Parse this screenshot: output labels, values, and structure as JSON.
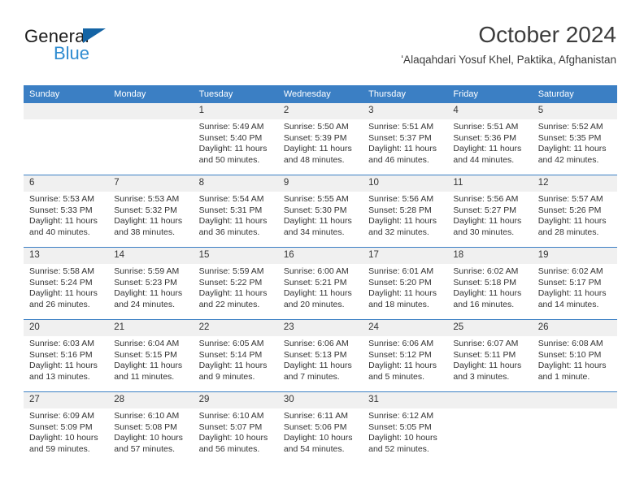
{
  "brand": {
    "name_part1": "General",
    "name_part2": "Blue",
    "triangle_icon": "triangle-icon",
    "accent_color": "#1464a5",
    "secondary_color": "#2e8bd0"
  },
  "header": {
    "title": "October 2024",
    "subtitle": "ʻAlaqahdari Yosuf Khel, Paktika, Afghanistan"
  },
  "calendar": {
    "header_bg": "#3b7fc4",
    "daynum_bg": "#f0f0f0",
    "weekday_headers": [
      "Sunday",
      "Monday",
      "Tuesday",
      "Wednesday",
      "Thursday",
      "Friday",
      "Saturday"
    ],
    "weeks": [
      [
        {
          "day": ""
        },
        {
          "day": ""
        },
        {
          "day": "1",
          "sunrise": "Sunrise: 5:49 AM",
          "sunset": "Sunset: 5:40 PM",
          "daylight1": "Daylight: 11 hours",
          "daylight2": "and 50 minutes."
        },
        {
          "day": "2",
          "sunrise": "Sunrise: 5:50 AM",
          "sunset": "Sunset: 5:39 PM",
          "daylight1": "Daylight: 11 hours",
          "daylight2": "and 48 minutes."
        },
        {
          "day": "3",
          "sunrise": "Sunrise: 5:51 AM",
          "sunset": "Sunset: 5:37 PM",
          "daylight1": "Daylight: 11 hours",
          "daylight2": "and 46 minutes."
        },
        {
          "day": "4",
          "sunrise": "Sunrise: 5:51 AM",
          "sunset": "Sunset: 5:36 PM",
          "daylight1": "Daylight: 11 hours",
          "daylight2": "and 44 minutes."
        },
        {
          "day": "5",
          "sunrise": "Sunrise: 5:52 AM",
          "sunset": "Sunset: 5:35 PM",
          "daylight1": "Daylight: 11 hours",
          "daylight2": "and 42 minutes."
        }
      ],
      [
        {
          "day": "6",
          "sunrise": "Sunrise: 5:53 AM",
          "sunset": "Sunset: 5:33 PM",
          "daylight1": "Daylight: 11 hours",
          "daylight2": "and 40 minutes."
        },
        {
          "day": "7",
          "sunrise": "Sunrise: 5:53 AM",
          "sunset": "Sunset: 5:32 PM",
          "daylight1": "Daylight: 11 hours",
          "daylight2": "and 38 minutes."
        },
        {
          "day": "8",
          "sunrise": "Sunrise: 5:54 AM",
          "sunset": "Sunset: 5:31 PM",
          "daylight1": "Daylight: 11 hours",
          "daylight2": "and 36 minutes."
        },
        {
          "day": "9",
          "sunrise": "Sunrise: 5:55 AM",
          "sunset": "Sunset: 5:30 PM",
          "daylight1": "Daylight: 11 hours",
          "daylight2": "and 34 minutes."
        },
        {
          "day": "10",
          "sunrise": "Sunrise: 5:56 AM",
          "sunset": "Sunset: 5:28 PM",
          "daylight1": "Daylight: 11 hours",
          "daylight2": "and 32 minutes."
        },
        {
          "day": "11",
          "sunrise": "Sunrise: 5:56 AM",
          "sunset": "Sunset: 5:27 PM",
          "daylight1": "Daylight: 11 hours",
          "daylight2": "and 30 minutes."
        },
        {
          "day": "12",
          "sunrise": "Sunrise: 5:57 AM",
          "sunset": "Sunset: 5:26 PM",
          "daylight1": "Daylight: 11 hours",
          "daylight2": "and 28 minutes."
        }
      ],
      [
        {
          "day": "13",
          "sunrise": "Sunrise: 5:58 AM",
          "sunset": "Sunset: 5:24 PM",
          "daylight1": "Daylight: 11 hours",
          "daylight2": "and 26 minutes."
        },
        {
          "day": "14",
          "sunrise": "Sunrise: 5:59 AM",
          "sunset": "Sunset: 5:23 PM",
          "daylight1": "Daylight: 11 hours",
          "daylight2": "and 24 minutes."
        },
        {
          "day": "15",
          "sunrise": "Sunrise: 5:59 AM",
          "sunset": "Sunset: 5:22 PM",
          "daylight1": "Daylight: 11 hours",
          "daylight2": "and 22 minutes."
        },
        {
          "day": "16",
          "sunrise": "Sunrise: 6:00 AM",
          "sunset": "Sunset: 5:21 PM",
          "daylight1": "Daylight: 11 hours",
          "daylight2": "and 20 minutes."
        },
        {
          "day": "17",
          "sunrise": "Sunrise: 6:01 AM",
          "sunset": "Sunset: 5:20 PM",
          "daylight1": "Daylight: 11 hours",
          "daylight2": "and 18 minutes."
        },
        {
          "day": "18",
          "sunrise": "Sunrise: 6:02 AM",
          "sunset": "Sunset: 5:18 PM",
          "daylight1": "Daylight: 11 hours",
          "daylight2": "and 16 minutes."
        },
        {
          "day": "19",
          "sunrise": "Sunrise: 6:02 AM",
          "sunset": "Sunset: 5:17 PM",
          "daylight1": "Daylight: 11 hours",
          "daylight2": "and 14 minutes."
        }
      ],
      [
        {
          "day": "20",
          "sunrise": "Sunrise: 6:03 AM",
          "sunset": "Sunset: 5:16 PM",
          "daylight1": "Daylight: 11 hours",
          "daylight2": "and 13 minutes."
        },
        {
          "day": "21",
          "sunrise": "Sunrise: 6:04 AM",
          "sunset": "Sunset: 5:15 PM",
          "daylight1": "Daylight: 11 hours",
          "daylight2": "and 11 minutes."
        },
        {
          "day": "22",
          "sunrise": "Sunrise: 6:05 AM",
          "sunset": "Sunset: 5:14 PM",
          "daylight1": "Daylight: 11 hours",
          "daylight2": "and 9 minutes."
        },
        {
          "day": "23",
          "sunrise": "Sunrise: 6:06 AM",
          "sunset": "Sunset: 5:13 PM",
          "daylight1": "Daylight: 11 hours",
          "daylight2": "and 7 minutes."
        },
        {
          "day": "24",
          "sunrise": "Sunrise: 6:06 AM",
          "sunset": "Sunset: 5:12 PM",
          "daylight1": "Daylight: 11 hours",
          "daylight2": "and 5 minutes."
        },
        {
          "day": "25",
          "sunrise": "Sunrise: 6:07 AM",
          "sunset": "Sunset: 5:11 PM",
          "daylight1": "Daylight: 11 hours",
          "daylight2": "and 3 minutes."
        },
        {
          "day": "26",
          "sunrise": "Sunrise: 6:08 AM",
          "sunset": "Sunset: 5:10 PM",
          "daylight1": "Daylight: 11 hours",
          "daylight2": "and 1 minute."
        }
      ],
      [
        {
          "day": "27",
          "sunrise": "Sunrise: 6:09 AM",
          "sunset": "Sunset: 5:09 PM",
          "daylight1": "Daylight: 10 hours",
          "daylight2": "and 59 minutes."
        },
        {
          "day": "28",
          "sunrise": "Sunrise: 6:10 AM",
          "sunset": "Sunset: 5:08 PM",
          "daylight1": "Daylight: 10 hours",
          "daylight2": "and 57 minutes."
        },
        {
          "day": "29",
          "sunrise": "Sunrise: 6:10 AM",
          "sunset": "Sunset: 5:07 PM",
          "daylight1": "Daylight: 10 hours",
          "daylight2": "and 56 minutes."
        },
        {
          "day": "30",
          "sunrise": "Sunrise: 6:11 AM",
          "sunset": "Sunset: 5:06 PM",
          "daylight1": "Daylight: 10 hours",
          "daylight2": "and 54 minutes."
        },
        {
          "day": "31",
          "sunrise": "Sunrise: 6:12 AM",
          "sunset": "Sunset: 5:05 PM",
          "daylight1": "Daylight: 10 hours",
          "daylight2": "and 52 minutes."
        },
        {
          "day": ""
        },
        {
          "day": ""
        }
      ]
    ]
  }
}
